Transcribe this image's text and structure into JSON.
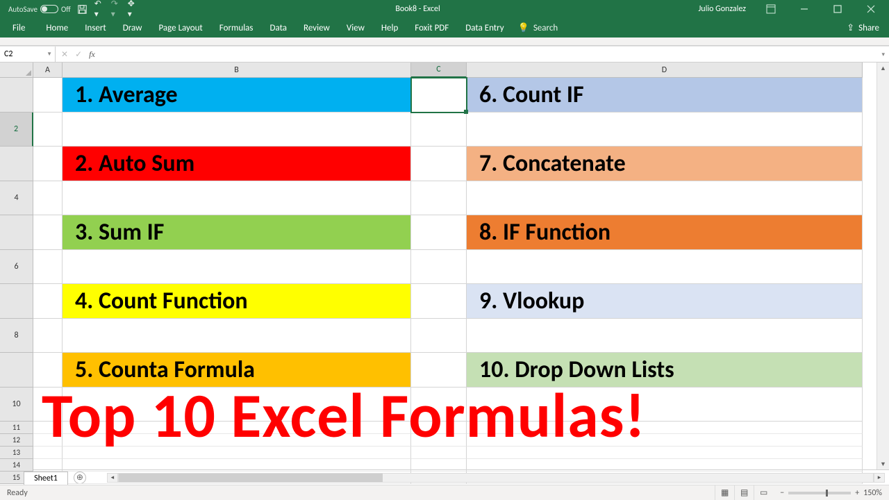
{
  "titlebar": {
    "autosave": "AutoSave",
    "off": "Off",
    "doc": "Book8  -  Excel",
    "user": "Julio Gonzalez"
  },
  "ribbon": {
    "tabs": [
      "File",
      "Home",
      "Insert",
      "Draw",
      "Page Layout",
      "Formulas",
      "Data",
      "Review",
      "View",
      "Help",
      "Foxit PDF",
      "Data Entry"
    ],
    "search": "Search",
    "share": "Share"
  },
  "fxbar": {
    "cellref": "C2"
  },
  "grid": {
    "cols": [
      "A",
      "B",
      "C",
      "D"
    ],
    "rows": [
      "2",
      "4",
      "6",
      "8",
      "10",
      "11",
      "12",
      "13",
      "14",
      "15"
    ],
    "left": [
      "1.  Average",
      "2.  Auto Sum",
      "3.  Sum IF",
      "4.  Count Function",
      "5.  Counta  Formula"
    ],
    "right": [
      "6.  Count IF",
      "7.  Concatenate",
      "8.  IF Function",
      "9.  Vlookup",
      "10.  Drop Down Lists"
    ],
    "heading": "Top 10 Excel Formulas!"
  },
  "sheetbar": {
    "sheet": "Sheet1"
  },
  "status": {
    "ready": "Ready",
    "zoom": "150%"
  },
  "colors": {
    "left": [
      "c-blue",
      "c-red",
      "c-green",
      "c-yellow",
      "c-orange"
    ],
    "right": [
      "c-lav",
      "c-coral",
      "c-dorange",
      "c-pale",
      "c-sage"
    ]
  }
}
